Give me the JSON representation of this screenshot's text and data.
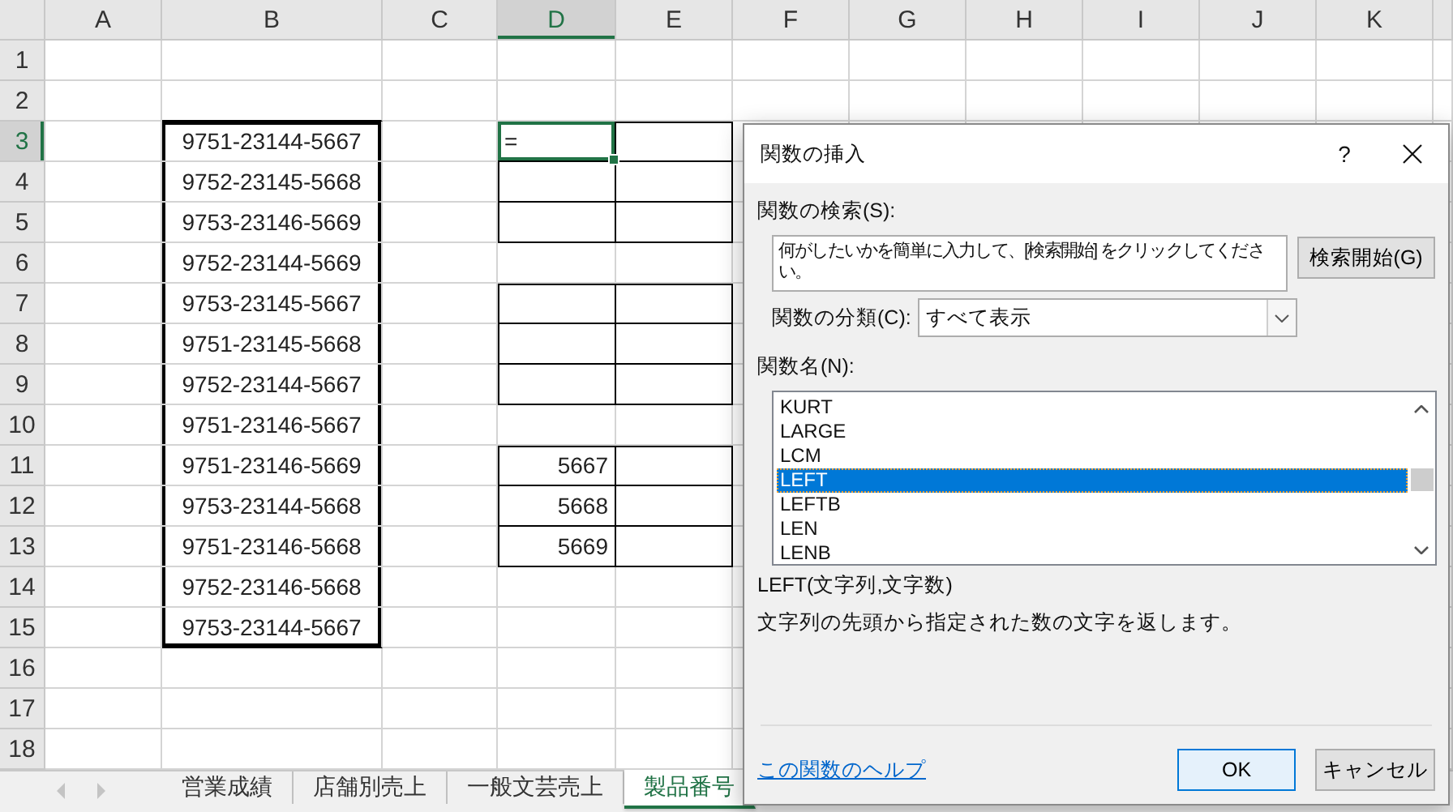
{
  "sheet": {
    "columns": [
      {
        "label": "A",
        "selected": false
      },
      {
        "label": "B",
        "selected": false
      },
      {
        "label": "C",
        "selected": false
      },
      {
        "label": "D",
        "selected": true
      },
      {
        "label": "E",
        "selected": false
      },
      {
        "label": "F",
        "selected": false
      },
      {
        "label": "G",
        "selected": false
      },
      {
        "label": "H",
        "selected": false
      },
      {
        "label": "I",
        "selected": false
      },
      {
        "label": "J",
        "selected": false
      },
      {
        "label": "K",
        "selected": false
      }
    ],
    "rows": [
      {
        "number": "1",
        "selected": false
      },
      {
        "number": "2",
        "selected": false
      },
      {
        "number": "3",
        "selected": true,
        "column_B": "9751-23144-5667",
        "column_D": {
          "text": "=",
          "kind": "text"
        }
      },
      {
        "number": "4",
        "selected": false,
        "column_B": "9752-23145-5668"
      },
      {
        "number": "5",
        "selected": false,
        "column_B": "9753-23146-5669"
      },
      {
        "number": "6",
        "selected": false,
        "column_B": "9752-23144-5669"
      },
      {
        "number": "7",
        "selected": false,
        "column_B": "9753-23145-5667"
      },
      {
        "number": "8",
        "selected": false,
        "column_B": "9751-23145-5668"
      },
      {
        "number": "9",
        "selected": false,
        "column_B": "9752-23144-5667"
      },
      {
        "number": "10",
        "selected": false,
        "column_B": "9751-23146-5667"
      },
      {
        "number": "11",
        "selected": false,
        "column_B": "9751-23146-5669",
        "column_D": {
          "text": "5667",
          "kind": "number"
        }
      },
      {
        "number": "12",
        "selected": false,
        "column_B": "9753-23144-5668",
        "column_D": {
          "text": "5668",
          "kind": "number"
        }
      },
      {
        "number": "13",
        "selected": false,
        "column_B": "9751-23146-5668",
        "column_D": {
          "text": "5669",
          "kind": "number"
        }
      },
      {
        "number": "14",
        "selected": false,
        "column_B": "9752-23146-5668"
      },
      {
        "number": "15",
        "selected": false,
        "column_B": "9753-23144-5667"
      },
      {
        "number": "16",
        "selected": false
      },
      {
        "number": "17",
        "selected": false
      },
      {
        "number": "18",
        "selected": false
      }
    ],
    "tabs": [
      {
        "label": "営業成績",
        "selected": false
      },
      {
        "label": "店舗別売上",
        "selected": false
      },
      {
        "label": "一般文芸売上",
        "selected": false
      },
      {
        "label": "製品番号",
        "selected": true
      }
    ]
  },
  "dialog": {
    "title": "関数の挿入",
    "help_button": "?",
    "search_label": "関数の検索(S):",
    "search_field": {
      "value": "何がしたいかを簡単に入力して、[検索開始] をクリックしてください。"
    },
    "search_button": "検索開始(G)",
    "category_label": "関数の分類(C):",
    "category": {
      "value": "すべて表示"
    },
    "names_label": "関数名(N):",
    "functions": [
      {
        "label": "KURT",
        "selected": false
      },
      {
        "label": "LARGE",
        "selected": false
      },
      {
        "label": "LCM",
        "selected": false
      },
      {
        "label": "LEFT",
        "selected": true
      },
      {
        "label": "LEFTB",
        "selected": false
      },
      {
        "label": "LEN",
        "selected": false
      },
      {
        "label": "LENB",
        "selected": false
      }
    ],
    "syntax": "LEFT(文字列,文字数)",
    "description": "文字列の先頭から指定された数の文字を返します。",
    "help_link": "この関数のヘルプ",
    "buttons": [
      {
        "label": "OK",
        "kind": "default"
      },
      {
        "label": "キャンセル",
        "kind": "normal"
      }
    ]
  }
}
